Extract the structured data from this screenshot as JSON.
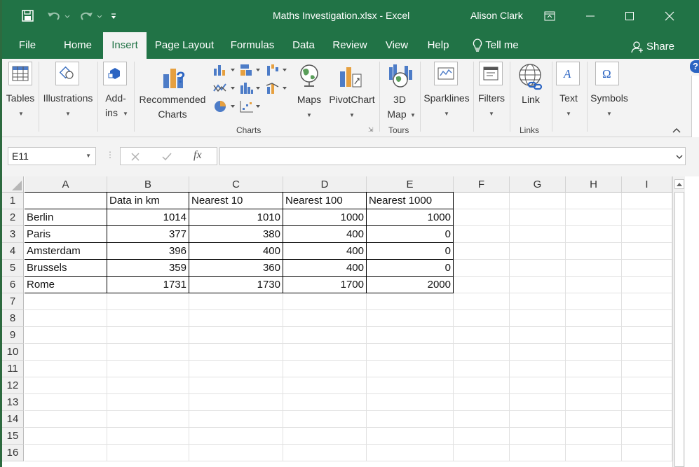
{
  "window": {
    "title": "Maths Investigation.xlsx  -  Excel",
    "user": "Alison Clark",
    "share": "Share"
  },
  "tabs": [
    "File",
    "Home",
    "Insert",
    "Page Layout",
    "Formulas",
    "Data",
    "Review",
    "View",
    "Help"
  ],
  "tell_me": "Tell me",
  "ribbon": {
    "tables": "Tables",
    "illustrations": "Illustrations",
    "addins_1": "Add-",
    "addins_2": "ins",
    "recommended_1": "Recommended",
    "recommended_2": "Charts",
    "maps": "Maps",
    "pivotchart": "PivotChart",
    "map3d_1": "3D",
    "map3d_2": "Map",
    "sparklines": "Sparklines",
    "filters": "Filters",
    "link": "Link",
    "text": "Text",
    "symbols": "Symbols",
    "group_charts": "Charts",
    "group_tours": "Tours",
    "group_links": "Links"
  },
  "namebox": "E11",
  "fx": "fx",
  "columns": [
    "A",
    "B",
    "C",
    "D",
    "E",
    "F",
    "G",
    "H",
    "I"
  ],
  "rows": [
    "1",
    "2",
    "3",
    "4",
    "5",
    "6",
    "7",
    "8",
    "9",
    "10",
    "11",
    "12",
    "13",
    "14",
    "15",
    "16"
  ],
  "cells": {
    "header": [
      "",
      "Data in km",
      "Nearest 10",
      "Nearest 100",
      "Nearest 1000"
    ],
    "data": [
      [
        "Berlin",
        "1014",
        "1010",
        "1000",
        "1000"
      ],
      [
        "Paris",
        "377",
        "380",
        "400",
        "0"
      ],
      [
        "Amsterdam",
        "396",
        "400",
        "400",
        "0"
      ],
      [
        "Brussels",
        "359",
        "360",
        "400",
        "0"
      ],
      [
        "Rome",
        "1731",
        "1730",
        "1700",
        "2000"
      ]
    ]
  },
  "colors": {
    "accent": "#217346",
    "ribbon_bg": "#f3f3f3"
  }
}
